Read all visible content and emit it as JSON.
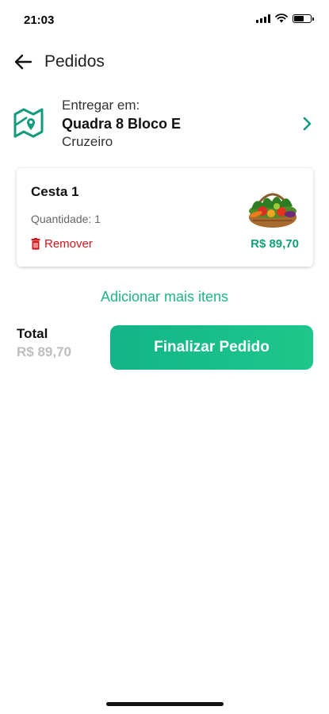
{
  "status_bar": {
    "time": "21:03"
  },
  "header": {
    "title": "Pedidos",
    "back_icon": "arrow-left-icon"
  },
  "address": {
    "label": "Entregar em:",
    "street": "Quadra 8 Bloco E",
    "city": "Cruzeiro",
    "icon": "map-pin-icon"
  },
  "cart": {
    "items": [
      {
        "name": "Cesta 1",
        "quantity_text": "Quantidade: 1",
        "remove_label": "Remover",
        "price": "R$ 89,70",
        "image": "vegetable-basket-image"
      }
    ],
    "add_more_label": "Adicionar mais itens"
  },
  "footer": {
    "total_label": "Total",
    "total_value": "R$ 89,70",
    "finish_label": "Finalizar Pedido"
  },
  "colors": {
    "accent": "#1fb585",
    "danger": "#d0181b",
    "muted": "#bdbdbd"
  }
}
